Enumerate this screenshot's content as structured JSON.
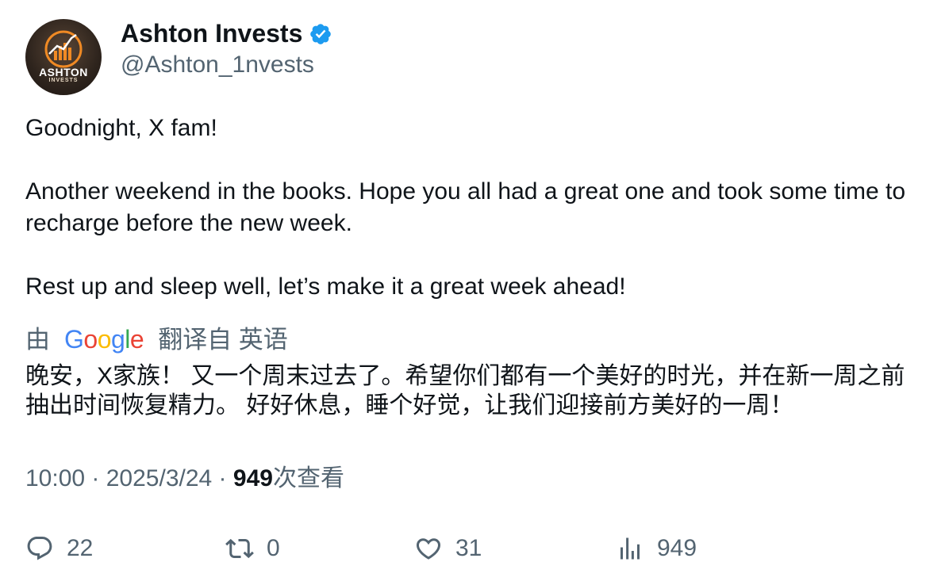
{
  "author": {
    "display_name": "Ashton Invests",
    "handle": "@Ashton_1nvests",
    "verified": true,
    "verified_color": "#1d9bf0",
    "avatar": {
      "brand_name": "ASHTON",
      "brand_sub": "INVESTS",
      "accent_color": "#f08a24"
    }
  },
  "tweet": {
    "text": "Goodnight, X fam!\n\nAnother weekend in the books. Hope you all had a great one and took some time to recharge before the new week.\n\nRest up and sleep well, let’s make it a great week ahead!"
  },
  "translation": {
    "by_label": "由",
    "provider_name": "Google",
    "translated_from_label": "翻译自 英语",
    "text": "晚安，X家族！ 又一个周末过去了。希望你们都有一个美好的时光，并在新一周之前抽出时间恢复精力。 好好休息，睡个好觉，让我们迎接前方美好的一周！"
  },
  "meta": {
    "time": "10:00",
    "separator": " · ",
    "date": "2025/3/24",
    "views_count": "949",
    "views_label": "次查看"
  },
  "actions": {
    "reply": {
      "icon": "reply-icon",
      "count": "22"
    },
    "retweet": {
      "icon": "retweet-icon",
      "count": "0"
    },
    "like": {
      "icon": "heart-icon",
      "count": "31"
    },
    "views": {
      "icon": "views-chart-icon",
      "count": "949"
    }
  }
}
